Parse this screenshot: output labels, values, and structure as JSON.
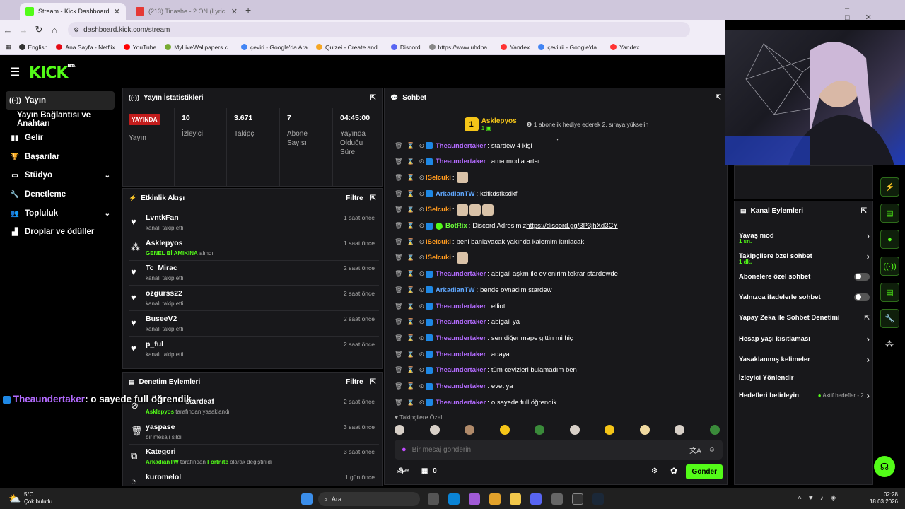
{
  "browser": {
    "tabs": [
      {
        "title": "Stream - Kick Dashboard",
        "active": true
      },
      {
        "title": "(213) Tinashe - 2 ON (Lyric",
        "active": false
      }
    ],
    "url": "dashboard.kick.com/stream",
    "bookmarks": [
      "English",
      "Ana Sayfa - Netflix",
      "YouTube",
      "MyLiveWallpapers.c...",
      "çeviri - Google'da Ara",
      "Quizei - Create and...",
      "Discord",
      "https://www.uhdpa...",
      "Yandex",
      "çeviirii - Google'da...",
      "Yandex"
    ]
  },
  "kick": {
    "logo": "KICK",
    "logo_sup": "BETA"
  },
  "sidebar": {
    "items": [
      {
        "label": "Yayın"
      },
      {
        "label": "Yayın Bağlantısı ve Anahtarı"
      },
      {
        "label": "Gelir"
      },
      {
        "label": "Başarılar"
      },
      {
        "label": "Stüdyo"
      },
      {
        "label": "Denetleme"
      },
      {
        "label": "Topluluk"
      },
      {
        "label": "Droplar ve ödüller"
      }
    ]
  },
  "stats": {
    "title": "Yayın İstatistikleri",
    "live_badge": "YAYINDA",
    "live_label": "Yayın",
    "cells": [
      {
        "value": "10",
        "label": "İzleyici"
      },
      {
        "value": "3.671",
        "label": "Takipçi"
      },
      {
        "value": "7",
        "label": "Abone Sayısı"
      },
      {
        "value": "04:45:00",
        "label": "Yayında Olduğu Süre"
      }
    ]
  },
  "events": {
    "title": "Etkinlik Akışı",
    "filter": "Filtre",
    "items": [
      {
        "name": "LvntkFan",
        "sub": "kanalı takip etti",
        "time": "1 saat önce"
      },
      {
        "name": "Asklepyos",
        "sub_highlight": "GENEL Bİ AMIKINA",
        "sub": " alındı",
        "time": "1 saat önce"
      },
      {
        "name": "Tc_Mirac",
        "sub": "kanalı takip etti",
        "time": "2 saat önce"
      },
      {
        "name": "ozgurss22",
        "sub": "kanalı takip etti",
        "time": "2 saat önce"
      },
      {
        "name": "BuseeV2",
        "sub": "kanalı takip etti",
        "time": "2 saat önce"
      },
      {
        "name": "p_ful",
        "sub": "kanalı takip etti",
        "time": "2 saat önce"
      }
    ]
  },
  "moderation": {
    "title": "Denetim Eylemleri",
    "filter": "Filtre",
    "items": [
      {
        "name": "stardeaf",
        "sub_highlight": "Asklepyos",
        "sub": " tarafından yasaklandı",
        "time": "2 saat önce"
      },
      {
        "name": "yaspase",
        "sub": "bir mesajı sildi",
        "time": "3 saat önce"
      },
      {
        "name": "Kategori",
        "sub_highlight": "ArkadianTW",
        "sub_mid": " tarafından ",
        "sub_highlight2": "Fortnite",
        "sub": " olarak değiştirildi",
        "time": "3 saat önce"
      },
      {
        "name": "kuromelol",
        "time": "1 gün önce"
      }
    ]
  },
  "chat": {
    "title": "Sohbet",
    "pinned_user": "Asklepyos",
    "pinned_rank": "1",
    "pinned_count": "1",
    "pinned_text": "1 abonelik hediye ederek 2. sıraya yükselin",
    "messages": [
      {
        "user": "Theaundertaker",
        "color": "purple",
        "text": "stardew 4 kişi"
      },
      {
        "user": "Theaundertaker",
        "color": "purple",
        "text": "ama modla artar"
      },
      {
        "user": "ISelcuki",
        "color": "orange",
        "text": "",
        "emotes": 1
      },
      {
        "user": "ArkadianTW",
        "color": "blue",
        "text": "kdfkdsfksdkf"
      },
      {
        "user": "ISelcuki",
        "color": "orange",
        "text": "",
        "emotes": 3
      },
      {
        "user": "BotRix",
        "color": "bgreen",
        "text": "Discord Adresimiz ",
        "link": "https://discord.gg/3P3jhXd3CY"
      },
      {
        "user": "ISelcuki",
        "color": "orange",
        "text": "beni banlayacak yakında kalemim kırılacak"
      },
      {
        "user": "ISelcuki",
        "color": "orange",
        "text": "",
        "emotes": 1
      },
      {
        "user": "Theaundertaker",
        "color": "purple",
        "text": "abigail aşkm ile evlenirim tekrar stardewde"
      },
      {
        "user": "ArkadianTW",
        "color": "blue",
        "text": "bende oynadım stardew"
      },
      {
        "user": "Theaundertaker",
        "color": "purple",
        "text": "elliot"
      },
      {
        "user": "Theaundertaker",
        "color": "purple",
        "text": "abigail ya"
      },
      {
        "user": "Theaundertaker",
        "color": "purple",
        "text": "sen diğer mape gittin mi hiç"
      },
      {
        "user": "Theaundertaker",
        "color": "purple",
        "text": "adaya"
      },
      {
        "user": "Theaundertaker",
        "color": "purple",
        "text": "tüm cevizleri bulamadım ben"
      },
      {
        "user": "Theaundertaker",
        "color": "purple",
        "text": "evet ya"
      },
      {
        "user": "Theaundertaker",
        "color": "purple",
        "text": "o sayede full öğrendik"
      }
    ],
    "followers_only_label": "Takipçilere Özel",
    "input_placeholder": "Bir mesaj gönderin",
    "points": "0",
    "send": "Gönder"
  },
  "actions": {
    "title": "Kanal Eylemleri",
    "items": [
      {
        "label": "Yavaş mod",
        "sub": "1 sn.",
        "type": "chev"
      },
      {
        "label": "Takipçilere özel sohbet",
        "sub": "1 dk.",
        "type": "chev"
      },
      {
        "label": "Abonelere özel sohbet",
        "type": "toggle"
      },
      {
        "label": "Yalnızca ifadelerle sohbet",
        "type": "toggle"
      },
      {
        "label": "Yapay Zeka ile Sohbet Denetimi",
        "type": "ext"
      },
      {
        "label": "Hesap yaşı kısıtlaması",
        "type": "chev"
      },
      {
        "label": "Yasaklanmış kelimeler",
        "type": "chev"
      },
      {
        "label": "İzleyici Yönlendir",
        "type": "none"
      },
      {
        "label": "Hedefleri belirleyin",
        "extra": "Aktif hedefler - 2",
        "type": "chev"
      }
    ]
  },
  "overlay": {
    "user": "Theaundertaker",
    "text": ": o sayede full öğrendik"
  },
  "taskbar": {
    "weather_temp": "5°C",
    "weather_desc": "Çok bulutlu",
    "search": "Ara",
    "time": "02:28",
    "date": "18.03.2026"
  },
  "colors": {
    "accent": "#53fc18",
    "panel": "#18181b",
    "live": "#c21c1c"
  }
}
